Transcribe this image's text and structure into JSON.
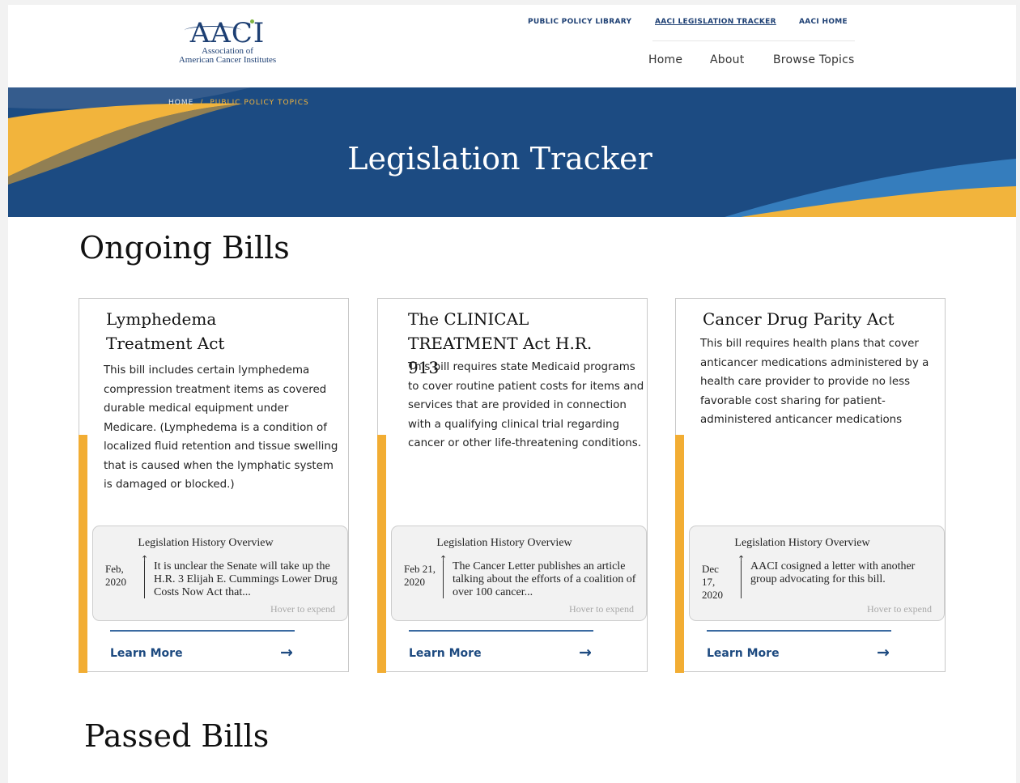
{
  "header": {
    "logo": {
      "mark": "AACI",
      "line1": "Association of",
      "line2": "American Cancer Institutes"
    },
    "top_links": [
      {
        "label": "PUBLIC POLICY LIBRARY"
      },
      {
        "label": "AACI LEGISLATION TRACKER",
        "active": true
      },
      {
        "label": "AACI HOME"
      }
    ],
    "main_nav": [
      {
        "label": "Home"
      },
      {
        "label": "About"
      },
      {
        "label": "Browse Topics"
      }
    ]
  },
  "hero": {
    "breadcrumb": {
      "home": "HOME",
      "separator": "/",
      "current": "PUBLIC POLICY TOPICS"
    },
    "title": "Legislation Tracker"
  },
  "sections": {
    "ongoing_title": "Ongoing Bills",
    "passed_title": "Passed Bills"
  },
  "cards": [
    {
      "title": "Lymphedema Treatment Act",
      "description": "This bill includes certain lymphedema compression treatment items as covered durable medical equipment under Medicare. (Lymphedema is a condition of localized fluid retention and tissue swelling that is caused when the lymphatic system is damaged or blocked.)",
      "history": {
        "title": "Legislation History Overview",
        "date": "Feb, 2020",
        "text": "It is unclear the Senate will take up the H.R. 3 Elijah E. Cummings Lower Drug Costs Now Act that...",
        "hint": "Hover to expend"
      },
      "learn_more": "Learn More",
      "arrow": "→"
    },
    {
      "title": "The CLINICAL TREATMENT Act H.R. 913",
      "description": "This bill requires state Medicaid programs to cover routine patient costs for items and services that are provided in connection with a qualifying clinical trial regarding cancer or other life-threatening conditions.",
      "history": {
        "title": "Legislation History Overview",
        "date": "Feb 21, 2020",
        "text": "The Cancer Letter publishes an article talking about the efforts of a coalition of over 100 cancer...",
        "hint": "Hover to expend"
      },
      "learn_more": "Learn More",
      "arrow": "→"
    },
    {
      "title": "Cancer Drug Parity Act",
      "description": "This bill requires health plans that cover anticancer medications administered by a health care provider to provide no less favorable cost sharing for patient-administered anticancer medications",
      "history": {
        "title": "Legislation History Overview",
        "date": "Dec 17, 2020",
        "text": "AACI cosigned a letter with another group advocating for this bill.",
        "hint": "Hover to expend"
      },
      "learn_more": "Learn More",
      "arrow": "→"
    }
  ],
  "colors": {
    "brand_blue": "#1c4b82",
    "accent_yellow": "#f2ad33",
    "link_blue": "#1d4a80"
  }
}
